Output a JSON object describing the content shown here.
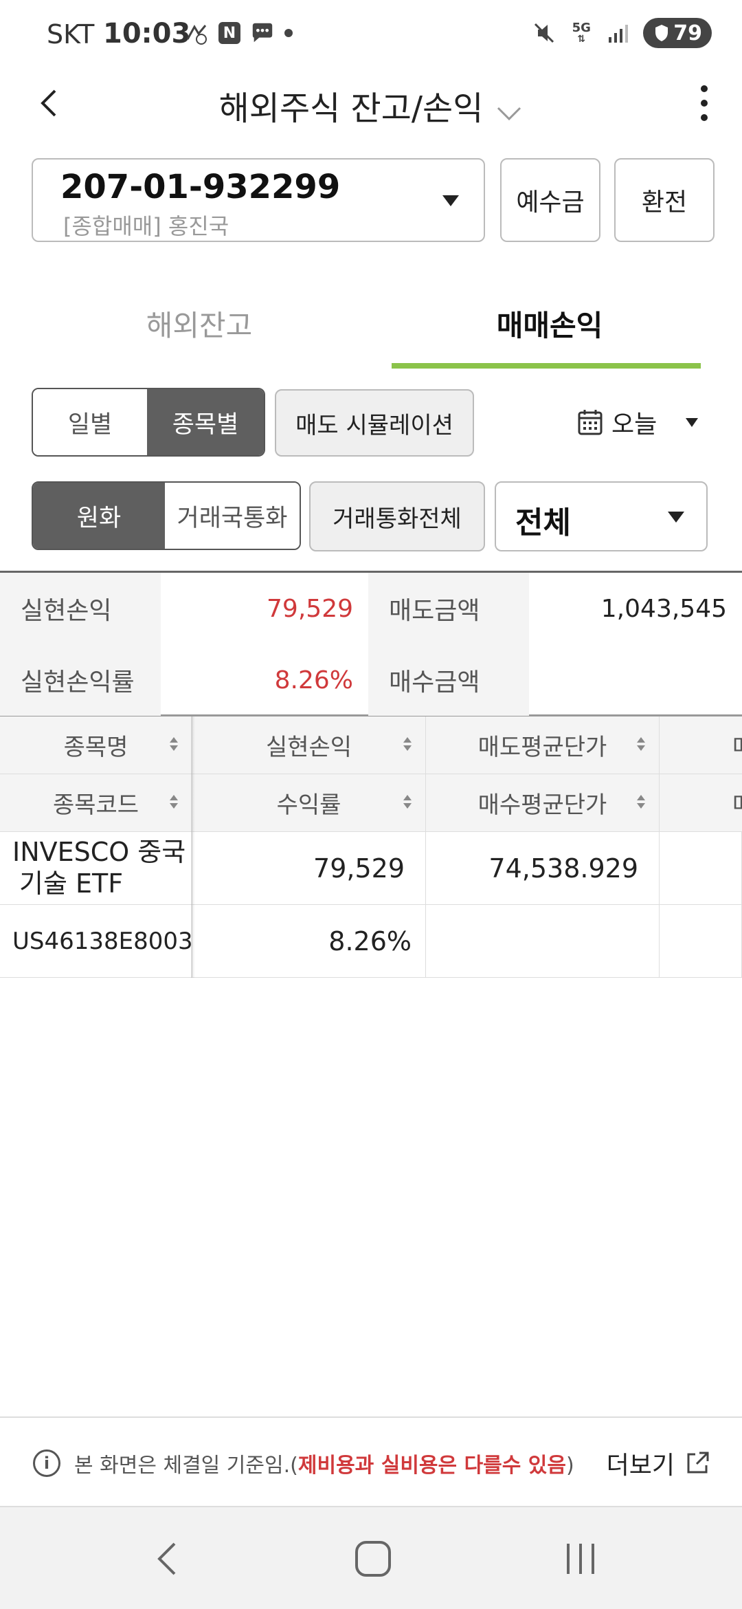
{
  "status_bar": {
    "carrier": "SKT",
    "time": "10:03",
    "network": "5G",
    "battery": "79"
  },
  "header": {
    "title": "해외주식 잔고/손익"
  },
  "account": {
    "number": "207-01-932299",
    "name": "[종합매매] 홍진국",
    "deposit_button": "예수금",
    "exchange_button": "환전"
  },
  "tabs": [
    {
      "label": "해외잔고",
      "active": false
    },
    {
      "label": "매매손익",
      "active": true
    }
  ],
  "filters": {
    "period": {
      "daily": "일별",
      "by_stock": "종목별",
      "selected": "종목별"
    },
    "simulation_button": "매도 시뮬레이션",
    "date": "오늘",
    "currency": {
      "krw": "원화",
      "trade_currency": "거래국통화",
      "selected": "원화"
    },
    "all_currency_button": "거래통화전체",
    "market_select": "전체"
  },
  "summary": {
    "realized_pl_label": "실현손익",
    "realized_pl": "79,529",
    "sell_amount_label": "매도금액",
    "sell_amount": "1,043,545",
    "realized_rate_label": "실현손익률",
    "realized_rate": "8.26%",
    "buy_amount_label": "매수금액",
    "buy_amount": ""
  },
  "table": {
    "headers_row1": [
      "종목명",
      "실현손익",
      "매도평균단가",
      "매"
    ],
    "headers_row2": [
      "종목코드",
      "수익률",
      "매수평균단가",
      "매"
    ],
    "rows": [
      {
        "name_line1": "INVESCO 중국",
        "name_line2": "기술 ETF",
        "code": "US46138E8003",
        "realized_pl": "79,529",
        "rate": "8.26%",
        "sell_avg_price": "74,538.929",
        "buy_avg_price": ""
      }
    ]
  },
  "notice": {
    "text": "본 화면은 체결일 기준임.",
    "open_paren": "(",
    "highlight": "제비용과 실비용은 다를수 있음",
    "close_paren": ")",
    "more": "더보기"
  },
  "colors": {
    "accent_green": "#8bc34a",
    "profit_red": "#d0393b",
    "segment_on": "#5f5f5f"
  }
}
